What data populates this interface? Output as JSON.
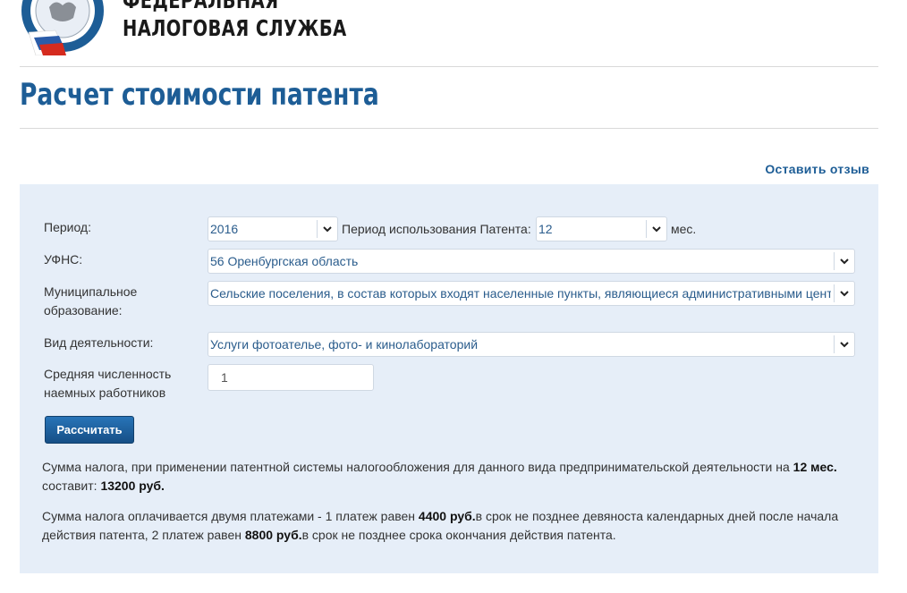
{
  "header": {
    "logo_line1": "ФЕДЕРАЛЬНАЯ",
    "logo_line2": "НАЛОГОВАЯ СЛУЖБА",
    "emblem_icon": "fns-emblem-icon",
    "colors": {
      "brand_blue": "#1d5d96",
      "panel_bg": "#e6eef8"
    }
  },
  "page": {
    "title": "Расчет стоимости патента",
    "feedback_link": "Оставить отзыв"
  },
  "form": {
    "period": {
      "label": "Период:",
      "value": "2016"
    },
    "usage_period": {
      "label": "Период использования Патента:",
      "value": "12",
      "unit": "мес."
    },
    "ufns": {
      "label": "УФНС:",
      "value": "56 Оренбургская область"
    },
    "municipality": {
      "label_line1": "Муниципальное",
      "label_line2": "образование:",
      "value": "Сельские поселения, в состав которых входят населенные пункты, являющиеся административными центрами"
    },
    "activity": {
      "label": "Вид деятельности:",
      "value": "Услуги фотоателье, фото- и кинолабораторий"
    },
    "employees": {
      "label_line1": "Средняя численность",
      "label_line2": "наемных работников",
      "value": "1"
    },
    "calculate_button": "Рассчитать"
  },
  "result": {
    "p1_text1": "Сумма налога, при применении патентной системы налогообложения для данного вида предпринимательской деятельности на ",
    "p1_months": "12 мес.",
    "p1_text2": "составит: ",
    "p1_total": "13200 руб.",
    "p2_text1": "Сумма налога оплачивается двумя платежами - 1 платеж равен ",
    "p2_amount1": "4400 руб.",
    "p2_text2": "в срок не позднее девяноста календарных дней после начала действия патента, 2 платеж равен ",
    "p2_amount2": "8800 руб.",
    "p2_text3": "в срок не позднее срока окончания действия патента."
  }
}
